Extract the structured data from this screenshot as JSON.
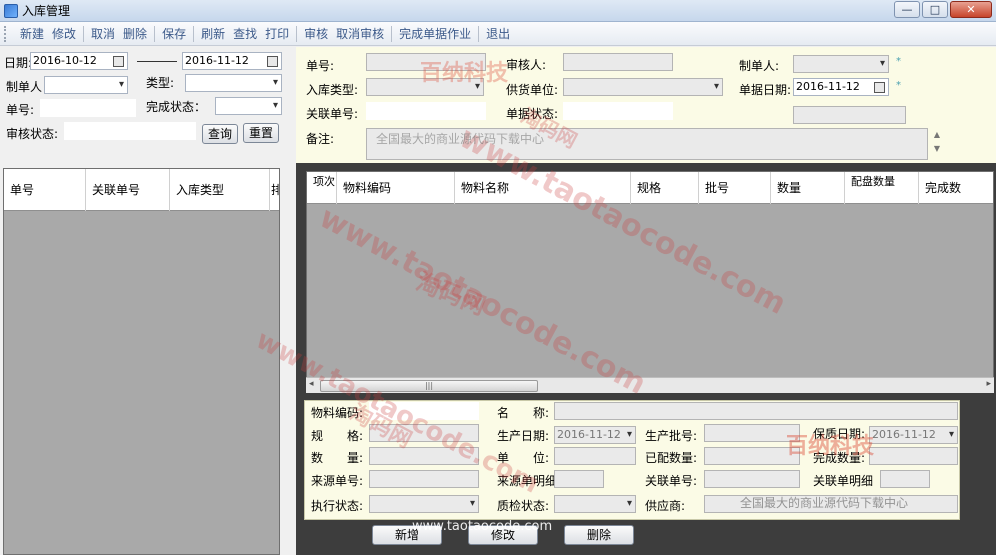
{
  "window": {
    "title": "入库管理",
    "minimize": "—",
    "maximize": "□",
    "close": "✕"
  },
  "toolbar": [
    "新建",
    "修改",
    "取消",
    "删除",
    "保存",
    "刷新",
    "查找",
    "打印",
    "审核",
    "取消审核",
    "完成单据作业",
    "退出"
  ],
  "filter": {
    "date_label": "日期:",
    "date_from": "2016-10-12",
    "date_to": "2016-11-12",
    "creator_label": "制单人",
    "type_label": "类型:",
    "docno_label": "单号:",
    "complete_label": "完成状态：",
    "audit_label": "审核状态:",
    "query_btn": "查询",
    "reset_btn": "重置"
  },
  "left_grid": {
    "columns": [
      "单号",
      "关联单号",
      "入库类型",
      "排"
    ]
  },
  "header_form": {
    "docno_label": "单号:",
    "auditor_label": "审核人:",
    "creator_label": "制单人:",
    "intype_label": "入库类型:",
    "supplier_label": "供货单位:",
    "docdate_label": "单据日期:",
    "docdate": "2016-11-12",
    "related_label": "关联单号:",
    "status_label": "单据状态:",
    "remark_label": "备注:"
  },
  "detail_grid": {
    "columns": [
      "项次",
      "物料编码",
      "物料名称",
      "规格",
      "批号",
      "数量",
      "配盘数量",
      "完成数"
    ]
  },
  "detail_form": {
    "code_label": "物料编码:",
    "name_label": "名　　称:",
    "spec_label": "规　　格:",
    "proddate_label": "生产日期:",
    "proddate": "2016-11-12",
    "batch_label": "生产批号:",
    "expdate_label": "保质日期:",
    "expdate": "2016-11-12",
    "qty_label": "数　　量:",
    "unit_label": "单　　位:",
    "assigned_label": "已配数量:",
    "doneqty_label": "完成数量:",
    "srcno_label": "来源单号:",
    "srcdetail_label": "来源单明细",
    "related_label": "关联单号:",
    "relateddetail_label": "关联单明细",
    "exec_label": "执行状态:",
    "qc_label": "质检状态:",
    "vendor_label": "供应商:"
  },
  "actions": {
    "add": "新增",
    "edit": "修改",
    "delete": "删除"
  },
  "watermarks": {
    "site": "www.taotaocode.com",
    "site_cn": "淘码网",
    "brand": "百纳科技",
    "slogan": "全国最大的商业源代码下载中心"
  }
}
